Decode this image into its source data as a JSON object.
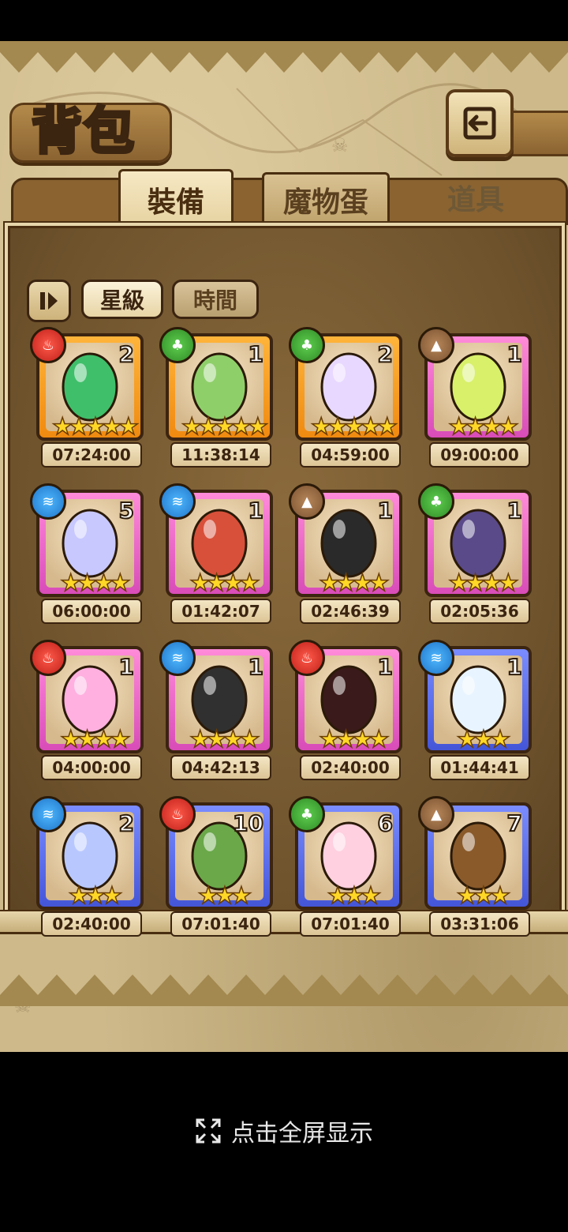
{
  "title": "背包",
  "tabs": [
    {
      "label": "裝備",
      "state": "active"
    },
    {
      "label": "魔物蛋",
      "state": "inactive"
    },
    {
      "label": "道具",
      "state": "dim"
    }
  ],
  "sort": {
    "toggle_icon": "sort-toggle-icon",
    "options": [
      {
        "label": "星級",
        "active": true
      },
      {
        "label": "時間",
        "active": false
      }
    ]
  },
  "eggs": [
    {
      "element": "fire",
      "count": "2",
      "stars": 5,
      "timer": "07:24:00",
      "frame": "gold",
      "egg_color": "#3fbf6a"
    },
    {
      "element": "leaf",
      "count": "1",
      "stars": 5,
      "timer": "11:38:14",
      "frame": "gold",
      "egg_color": "#8fcf6a"
    },
    {
      "element": "leaf",
      "count": "2",
      "stars": 5,
      "timer": "04:59:00",
      "frame": "gold",
      "egg_color": "#e8d8ff"
    },
    {
      "element": "earth",
      "count": "1",
      "stars": 4,
      "timer": "09:00:00",
      "frame": "pink",
      "egg_color": "#d8f06a"
    },
    {
      "element": "water",
      "count": "5",
      "stars": 4,
      "timer": "06:00:00",
      "frame": "pink",
      "egg_color": "#c8c8ff"
    },
    {
      "element": "water",
      "count": "1",
      "stars": 4,
      "timer": "01:42:07",
      "frame": "pink",
      "egg_color": "#d8503a"
    },
    {
      "element": "earth",
      "count": "1",
      "stars": 4,
      "timer": "02:46:39",
      "frame": "pink",
      "egg_color": "#2a2a2a"
    },
    {
      "element": "leaf",
      "count": "1",
      "stars": 4,
      "timer": "02:05:36",
      "frame": "pink",
      "egg_color": "#5a4a8a"
    },
    {
      "element": "fire",
      "count": "1",
      "stars": 4,
      "timer": "04:00:00",
      "frame": "pink",
      "egg_color": "#ffb0e0"
    },
    {
      "element": "water",
      "count": "1",
      "stars": 4,
      "timer": "04:42:13",
      "frame": "pink",
      "egg_color": "#303030"
    },
    {
      "element": "fire",
      "count": "1",
      "stars": 4,
      "timer": "02:40:00",
      "frame": "pink",
      "egg_color": "#3a1a1a"
    },
    {
      "element": "water",
      "count": "1",
      "stars": 3,
      "timer": "01:44:41",
      "frame": "blue",
      "egg_color": "#e8f4ff"
    },
    {
      "element": "water",
      "count": "2",
      "stars": 3,
      "timer": "02:40:00",
      "frame": "blue",
      "egg_color": "#b8c8ff"
    },
    {
      "element": "fire",
      "count": "10",
      "stars": 3,
      "timer": "07:01:40",
      "frame": "blue",
      "egg_color": "#6aa84a"
    },
    {
      "element": "leaf",
      "count": "6",
      "stars": 3,
      "timer": "07:01:40",
      "frame": "blue",
      "egg_color": "#ffd0e0"
    },
    {
      "element": "earth",
      "count": "7",
      "stars": 3,
      "timer": "03:31:06",
      "frame": "blue",
      "egg_color": "#8a5a2a"
    }
  ],
  "fullscreen_hint": "点击全屏显示",
  "icons": {
    "back": "back-arrow-icon",
    "fullscreen": "fullscreen-expand-icon"
  }
}
